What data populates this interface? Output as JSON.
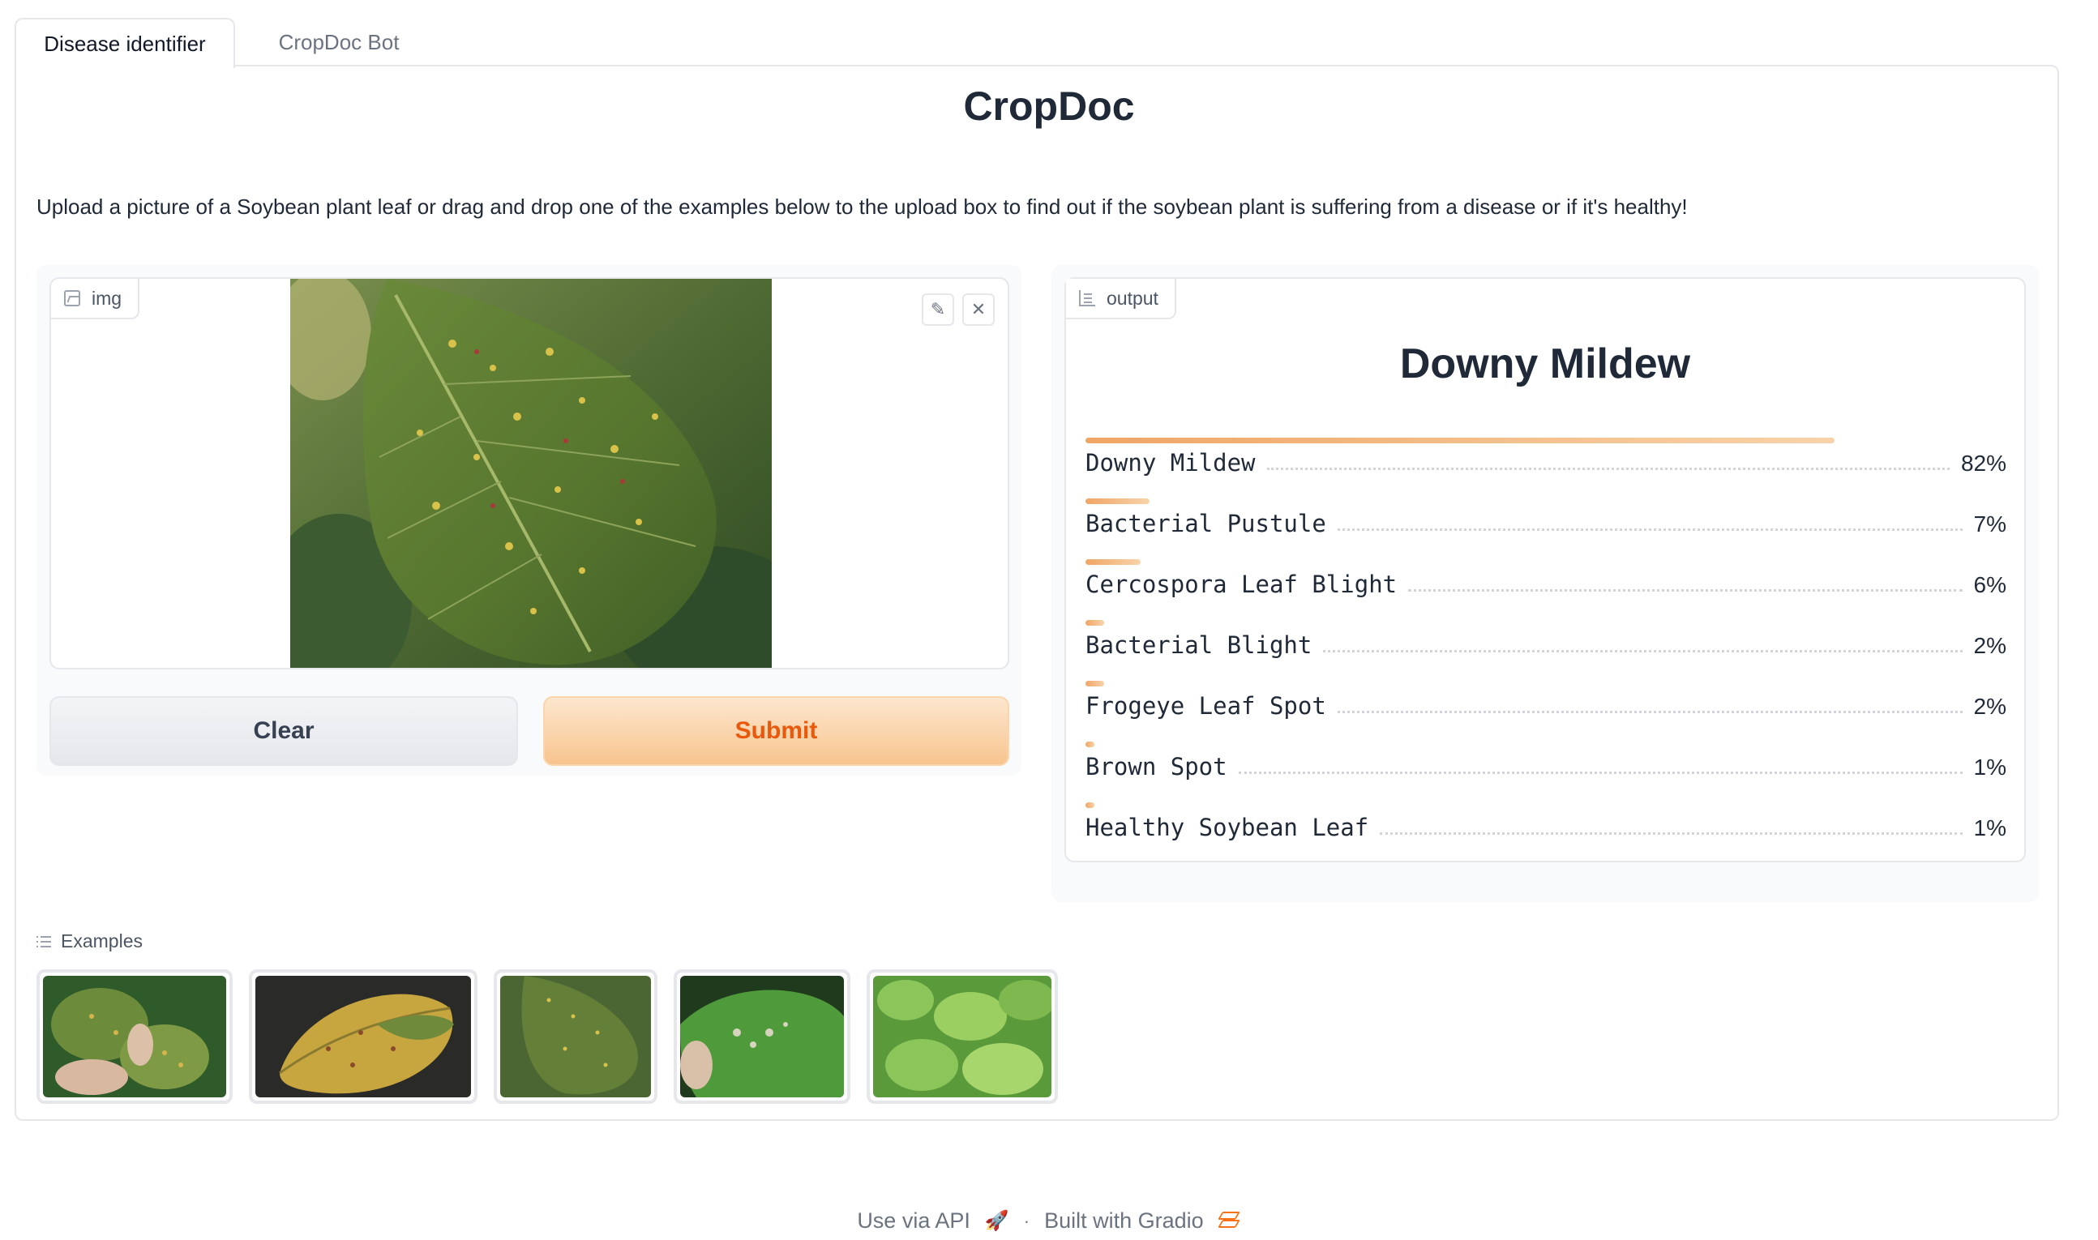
{
  "tabs": [
    {
      "label": "Disease identifier",
      "active": true
    },
    {
      "label": "CropDoc Bot",
      "active": false
    }
  ],
  "title": "CropDoc",
  "description": "Upload a picture of a Soybean plant leaf or drag and drop one of the examples below to the upload box to find out if the soybean plant is suffering from a disease or if it's healthy!",
  "input": {
    "label": "img",
    "icon": "image-icon",
    "tools": [
      "edit-icon",
      "close-icon"
    ]
  },
  "buttons": {
    "clear": "Clear",
    "submit": "Submit"
  },
  "output": {
    "label": "output",
    "icon": "bar-chart-icon",
    "predicted": "Downy Mildew",
    "confidences": [
      {
        "label": "Downy Mildew",
        "value": 0.82,
        "display": "82%"
      },
      {
        "label": "Bacterial Pustule",
        "value": 0.07,
        "display": "7%"
      },
      {
        "label": "Cercospora Leaf Blight",
        "value": 0.06,
        "display": "6%"
      },
      {
        "label": "Bacterial Blight",
        "value": 0.02,
        "display": "2%"
      },
      {
        "label": "Frogeye Leaf Spot",
        "value": 0.02,
        "display": "2%"
      },
      {
        "label": "Brown Spot",
        "value": 0.01,
        "display": "1%"
      },
      {
        "label": "Healthy Soybean Leaf",
        "value": 0.01,
        "display": "1%"
      }
    ]
  },
  "examples": {
    "label": "Examples",
    "icon": "list-icon",
    "count": 5
  },
  "footer": {
    "api": "Use via API",
    "separator": "·",
    "built": "Built with Gradio"
  },
  "colors": {
    "accent": "#ea580c",
    "bar_start": "#f0a565",
    "bar_end": "#f8d3a9"
  }
}
